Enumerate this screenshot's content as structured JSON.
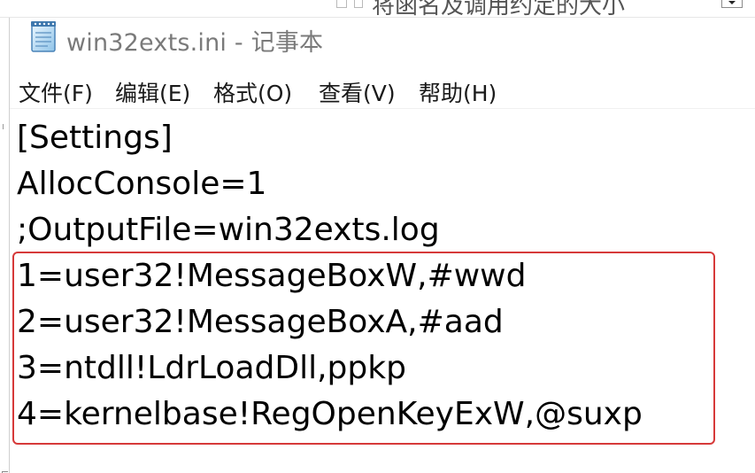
{
  "window": {
    "title": "win32exts.ini - 记事本"
  },
  "background": {
    "partial_text": "将函名及调用约定的大小"
  },
  "menu": {
    "items": [
      {
        "label": "文件(F)"
      },
      {
        "label": "编辑(E)"
      },
      {
        "label": "格式(O)"
      },
      {
        "label": "查看(V)"
      },
      {
        "label": "帮助(H)"
      }
    ]
  },
  "editor": {
    "lines": [
      "[Settings]",
      "AllocConsole=1",
      ";OutputFile=win32exts.log",
      "1=user32!MessageBoxW,#wwd",
      "2=user32!MessageBoxA,#aad",
      "3=ntdll!LdrLoadDll,ppkp",
      "4=kernelbase!RegOpenKeyExW,@suxp"
    ]
  },
  "colors": {
    "highlight_border": "#d63a3a",
    "title_text": "#7a7a7a"
  },
  "icons": {
    "app": "notepad-icon",
    "dropdown": "chevron-down-icon"
  }
}
